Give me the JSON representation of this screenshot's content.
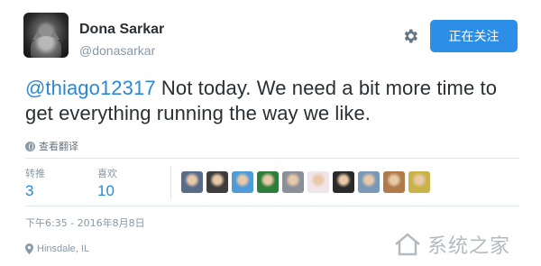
{
  "profile": {
    "display_name": "Dona Sarkar",
    "handle": "@donasarkar"
  },
  "header": {
    "settings_icon": "gear-icon",
    "follow_label": "正在关注",
    "follow_color": "#2c8ee6"
  },
  "tweet": {
    "mention": "@thiago12317",
    "text": " Not today. We need a bit more time to get everything running the way we like."
  },
  "translate": {
    "icon": "globe-icon",
    "label": "查看翻译"
  },
  "stats": {
    "retweets_label": "转推",
    "retweets_count": "3",
    "likes_label": "喜欢",
    "likes_count": "10"
  },
  "likers": [
    {
      "name": "liker-1",
      "color": "#5a6b8a"
    },
    {
      "name": "liker-2",
      "color": "#3d3d3d"
    },
    {
      "name": "liker-3",
      "color": "#4f9ad8"
    },
    {
      "name": "liker-4",
      "color": "#2e7d3a"
    },
    {
      "name": "liker-5",
      "color": "#8a8f99"
    },
    {
      "name": "liker-6",
      "color": "#f1e4ea"
    },
    {
      "name": "liker-7",
      "color": "#2a2a2a"
    },
    {
      "name": "liker-8",
      "color": "#7a99b8"
    },
    {
      "name": "liker-9",
      "color": "#b07a4a"
    },
    {
      "name": "liker-10",
      "color": "#c9b24a"
    }
  ],
  "timestamp": "下午6:35 - 2016年8月8日",
  "location": {
    "icon": "map-pin-icon",
    "label": "Hinsdale, IL"
  },
  "watermark": {
    "text": "系统之家"
  },
  "colors": {
    "link": "#2a88d4",
    "muted": "#8899a6",
    "text": "#292f33"
  }
}
